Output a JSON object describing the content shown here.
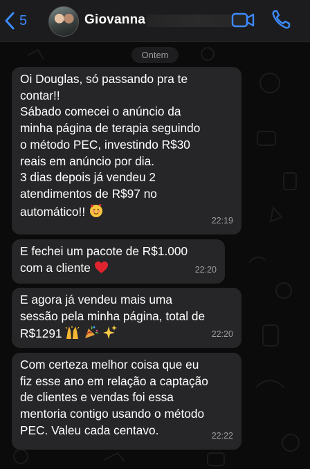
{
  "header": {
    "back_count": "5",
    "contact_name": "Giovanna"
  },
  "chat": {
    "date_label": "Ontem",
    "messages": [
      {
        "lines": [
          "Oi Douglas, só passando pra te",
          "contar!!",
          "Sábado comecei o anúncio da",
          "minha página de terapia seguindo",
          "o método PEC, investindo R$30",
          "reais em anúncio por dia.",
          "3 dias depois já vendeu 2",
          "atendimentos de R$97 no",
          "automático!!"
        ],
        "time": "22:19"
      },
      {
        "lines": [
          "E fechei um pacote de R$1.000",
          "com a cliente"
        ],
        "time": "22:20"
      },
      {
        "lines": [
          "E agora já vendeu mais uma",
          "sessão pela minha página, total de",
          "R$1291"
        ],
        "time": "22:20"
      },
      {
        "lines": [
          "Com certeza melhor coisa que eu",
          "fiz esse ano em relação a captação",
          "de clientes e vendas foi essa",
          "mentoria contigo usando o método",
          "PEC. Valeu cada centavo."
        ],
        "time": "22:22"
      }
    ]
  },
  "icons": [
    "chevron-left-icon",
    "video-camera-icon",
    "phone-icon",
    "smiling-face-with-hearts-icon",
    "red-heart-icon",
    "raising-hands-icon",
    "party-popper-icon",
    "sparkles-icon"
  ],
  "colors": {
    "accent": "#3d8bff",
    "bubble": "#262628",
    "background": "#0b0b0b"
  }
}
